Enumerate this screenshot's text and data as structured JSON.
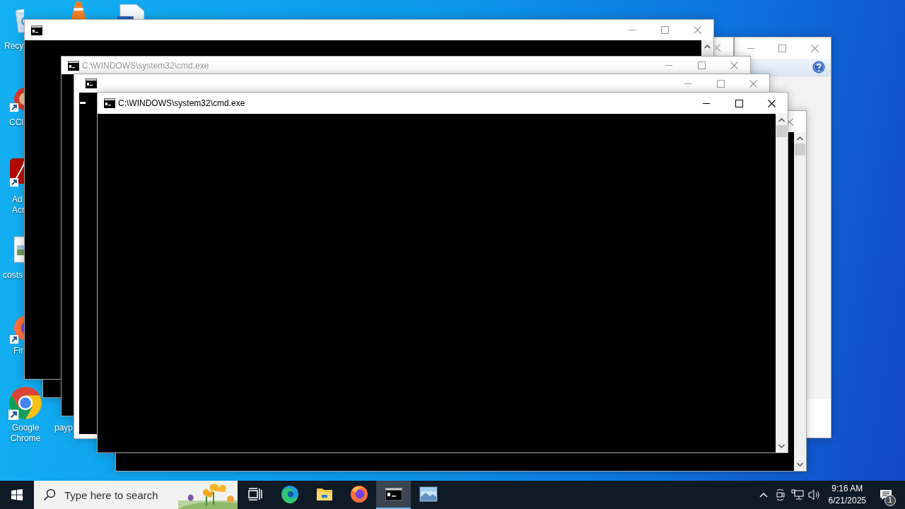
{
  "desktop": {
    "icons": [
      {
        "kind": "recycle-bin",
        "label_lines": [
          "Recy"
        ]
      },
      {
        "kind": "ccleaner",
        "label_lines": [
          "CCl"
        ]
      },
      {
        "kind": "acrobat",
        "label_lines": [
          "Ad",
          "Acr"
        ]
      },
      {
        "kind": "image-file",
        "label_lines": [
          "costs"
        ]
      },
      {
        "kind": "firefox",
        "label_lines": [
          "Fir"
        ]
      },
      {
        "kind": "chrome",
        "label_lines": [
          "Google",
          "Chrome"
        ]
      },
      {
        "kind": "document",
        "label_lines": [
          "payp"
        ]
      },
      {
        "kind": "vlc"
      },
      {
        "kind": "document"
      }
    ]
  },
  "windows": [
    {
      "kind": "dialog",
      "active": false
    },
    {
      "kind": "console",
      "active": false
    },
    {
      "kind": "console",
      "active": false
    },
    {
      "kind": "console"
    },
    {
      "kind": "console",
      "active": false
    },
    {
      "kind": "console",
      "title": "C:\\WINDOWS\\system32\\cmd.exe",
      "active": false
    },
    {
      "kind": "console",
      "active": false,
      "cursor": true
    },
    {
      "kind": "console",
      "title": "C:\\WINDOWS\\system32\\cmd.exe",
      "active": true
    }
  ],
  "taskbar": {
    "search": {
      "placeholder": "Type here to search"
    },
    "apps": [
      {
        "kind": "task-view",
        "selected": false
      },
      {
        "kind": "edge",
        "selected": false
      },
      {
        "kind": "explorer",
        "selected": false
      },
      {
        "kind": "firefox",
        "selected": false
      },
      {
        "kind": "console",
        "selected": true
      },
      {
        "kind": "photos",
        "selected": false
      }
    ],
    "clock": {
      "time": "9:16 AM",
      "date": "6/21/2025"
    },
    "notifications": "1"
  }
}
